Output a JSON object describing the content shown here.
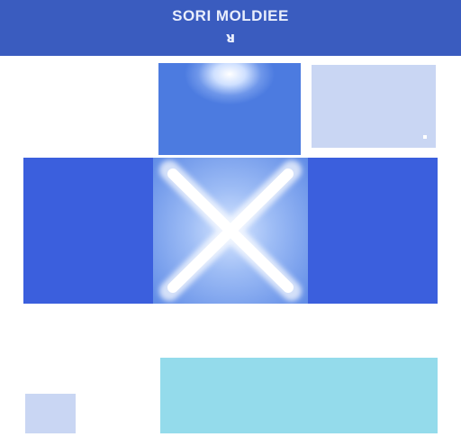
{
  "header": {
    "title": "SORI MOLDIEE",
    "subtitle": "ᴚ"
  },
  "colors": {
    "header_bg": "#3a5cbf",
    "tile_blue": "#3b5fdd",
    "tile_light": "#c9d6f3",
    "tile_mid": "#4c7be0",
    "tile_cyan": "#94dbeb",
    "x_mark": "#ffffff"
  },
  "tiles": {
    "center": {
      "icon": "x-icon"
    }
  }
}
